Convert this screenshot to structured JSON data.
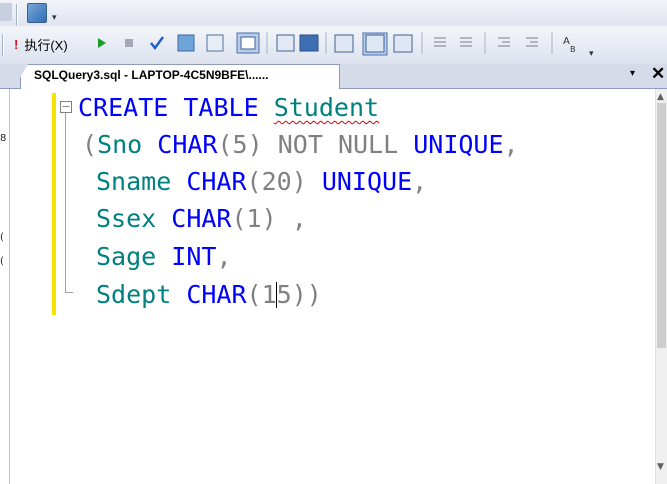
{
  "toolbar": {
    "execute_label": "执行(X)"
  },
  "tab": {
    "title": "SQLQuery3.sql - LAPTOP-4C5N9BFE\\......",
    "menu_glyph": "▾",
    "close_glyph": "✕"
  },
  "editor": {
    "lines": [
      {
        "parts": [
          "CREATE",
          " ",
          "TABLE",
          " ",
          "Student"
        ]
      },
      {
        "parts": [
          "(",
          "Sno",
          " ",
          "CHAR",
          "(5)",
          " ",
          "NOT",
          " ",
          "NULL",
          " ",
          "UNIQUE",
          ","
        ]
      },
      {
        "parts": [
          "Sname",
          " ",
          "CHAR",
          "(20)",
          " ",
          "UNIQUE",
          ","
        ]
      },
      {
        "parts": [
          "Ssex",
          " ",
          "CHAR",
          "(1)",
          " ",
          ","
        ]
      },
      {
        "parts": [
          "Sage",
          " ",
          "INT",
          ","
        ]
      },
      {
        "parts": [
          "Sdept",
          " ",
          "CHAR",
          "(1",
          "5))"
        ]
      }
    ]
  },
  "colors": {
    "keyword": "#0000ff",
    "identifier": "#008080",
    "punctuation": "#808080",
    "change_bar": "#f5e400"
  }
}
